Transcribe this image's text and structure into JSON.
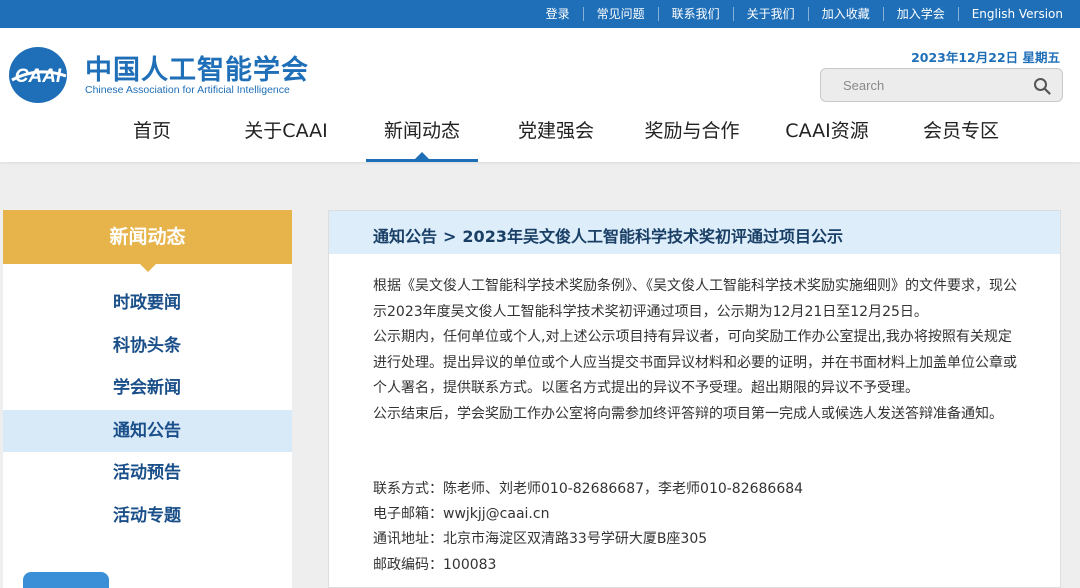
{
  "topbar": {
    "links": [
      "登录",
      "常见问题",
      "联系我们",
      "关于我们",
      "加入收藏",
      "加入学会",
      "English Version"
    ]
  },
  "header": {
    "logo_mark_text": "CAAI",
    "logo_cn": "中国人工智能学会",
    "logo_en": "Chinese Association for Artificial Intelligence",
    "date": "2023年12月22日 星期五",
    "search_placeholder": "Search"
  },
  "nav": {
    "items": [
      "首页",
      "关于CAAI",
      "新闻动态",
      "党建强会",
      "奖励与合作",
      "CAAI资源",
      "会员专区"
    ],
    "active": "新闻动态"
  },
  "sidebar": {
    "title": "新闻动态",
    "items": [
      "时政要闻",
      "科协头条",
      "学会新闻",
      "通知公告",
      "活动预告",
      "活动专题"
    ],
    "active": "通知公告"
  },
  "article": {
    "breadcrumb_section": "通知公告",
    "breadcrumb_sep": ">",
    "title": "2023年吴文俊人工智能科学技术奖初评通过项目公示",
    "paragraphs": [
      "根据《吴文俊人工智能科学技术奖励条例》、《吴文俊人工智能科学技术奖励实施细则》的文件要求，现公示2023年度吴文俊人工智能科学技术奖初评通过项目，公示期为12月21日至12月25日。",
      "公示期内，任何单位或个人,对上述公示项目持有异议者，可向奖励工作办公室提出,我办将按照有关规定进行处理。提出异议的单位或个人应当提交书面异议材料和必要的证明，并在书面材料上加盖单位公章或个人署名，提供联系方式。以匿名方式提出的异议不予受理。超出期限的异议不予受理。",
      "公示结束后，学会奖励工作办公室将向需参加终评答辩的项目第一完成人或候选人发送答辩准备通知。"
    ],
    "contact": [
      "联系方式：陈老师、刘老师010-82686687，李老师010-82686684",
      "电子邮箱：wwjkjj@caai.cn",
      "通讯地址：北京市海淀区双清路33号学研大厦B座305",
      "邮政编码：100083"
    ]
  },
  "colors": {
    "brand_blue": "#1f6fb8",
    "sidebar_header": "#e6b44a",
    "sidebar_active": "#d8e9f7",
    "content_header": "#ddeefa"
  }
}
